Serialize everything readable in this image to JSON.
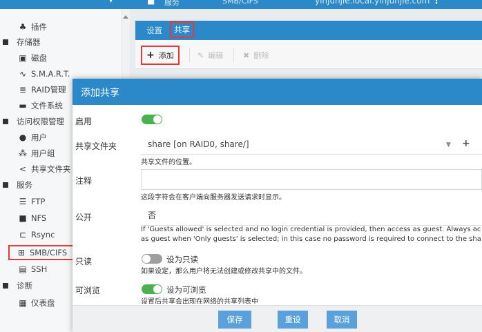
{
  "topbar": {
    "tab_1": "服务",
    "tab_2": "SMB/CIFS",
    "hostname": "yinjunjie.local.yinjunjie.com"
  },
  "sidebar": {
    "items": [
      {
        "type": "sub",
        "label": "插件",
        "icon": "puzzle-icon"
      },
      {
        "type": "cat",
        "label": "存储器"
      },
      {
        "type": "sub",
        "label": "磁盘",
        "icon": "disk-icon"
      },
      {
        "type": "sub",
        "label": "S.M.A.R.T.",
        "icon": "pulse-icon"
      },
      {
        "type": "sub",
        "label": "RAID管理",
        "icon": "database-icon"
      },
      {
        "type": "sub",
        "label": "文件系统",
        "icon": "folder-icon"
      },
      {
        "type": "cat",
        "label": "访问权限管理"
      },
      {
        "type": "sub",
        "label": "用户",
        "icon": "user-icon"
      },
      {
        "type": "sub",
        "label": "用户组",
        "icon": "users-icon"
      },
      {
        "type": "sub",
        "label": "共享文件夹",
        "icon": "share-icon"
      },
      {
        "type": "cat",
        "label": "服务"
      },
      {
        "type": "sub",
        "label": "FTP",
        "icon": "ftp-icon"
      },
      {
        "type": "sub",
        "label": "NFS",
        "icon": "nfs-icon"
      },
      {
        "type": "sub",
        "label": "Rsync",
        "icon": "rsync-icon"
      },
      {
        "type": "sub",
        "label": "SMB/CIFS",
        "icon": "windows-icon",
        "active": true
      },
      {
        "type": "sub",
        "label": "SSH",
        "icon": "terminal-icon"
      },
      {
        "type": "cat",
        "label": "诊断"
      },
      {
        "type": "sub",
        "label": "仪表盘",
        "icon": "dashboard-icon"
      }
    ]
  },
  "main": {
    "tabs": [
      "设置",
      "共享"
    ],
    "toolbar": {
      "add": "添加",
      "edit": "编辑",
      "delete": "删除"
    }
  },
  "modal": {
    "title": "添加共享",
    "enabled_label": "启用",
    "shared_folder_label": "共享文件夹",
    "shared_folder_value": "share [on RAID0, share/]",
    "shared_folder_hint": "共享文件的位置。",
    "comment_label": "注释",
    "comment_value": "",
    "comment_hint": "这段字符会在客户端向服务器发送请求时显示。",
    "public_label": "公开",
    "public_value": "否",
    "public_hint_1": "If 'Guests allowed' is selected and no login credential is provided, then access as guest. Always ac",
    "public_hint_2": "as guest when 'Only guests' is selected; in this case no password is required to connect to the sha",
    "readonly_label": "只读",
    "readonly_switch_text": "设为只读",
    "readonly_hint": "如果设定，那么用户将无法创建或修改共享中的文件。",
    "browseable_label": "可浏览",
    "browseable_switch_text": "设为可浏览",
    "browseable_hint": "设置后共享会出现在网络的共享列表中",
    "buttons": {
      "save": "保存",
      "reset": "重设",
      "cancel": "取消"
    }
  },
  "colors": {
    "accent": "#2b88c9",
    "switch_on": "#4caf50",
    "highlight": "#e53935",
    "button": "#5aa0da"
  }
}
